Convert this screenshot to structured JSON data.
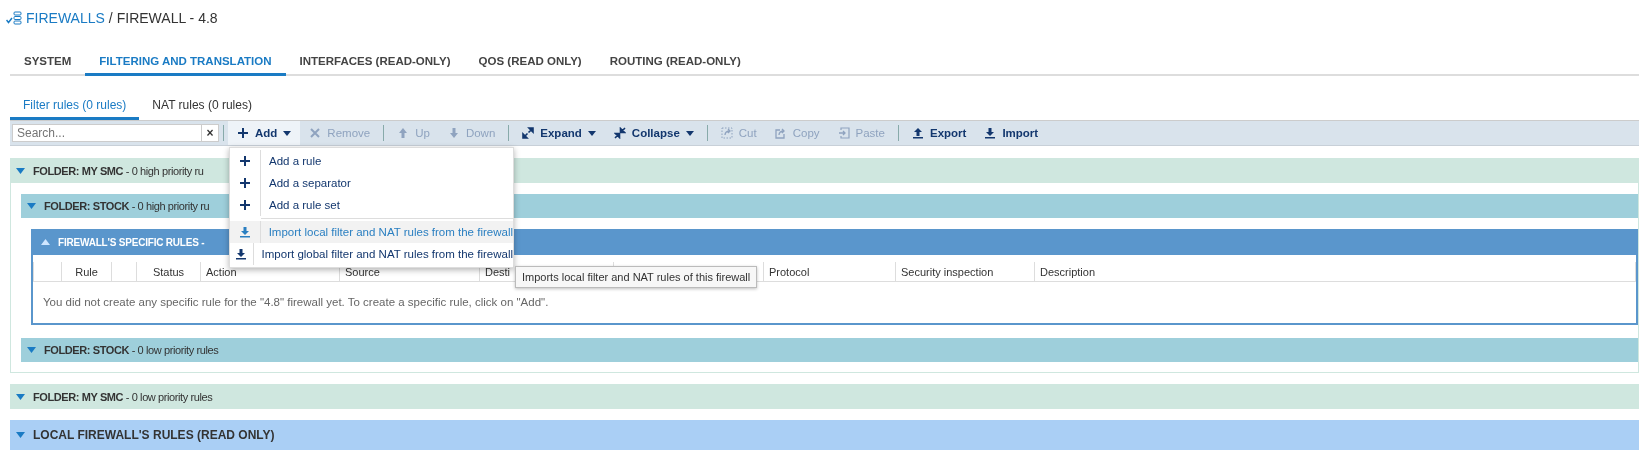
{
  "breadcrumb": {
    "parent": "FIREWALLS",
    "separator": "/",
    "current": "FIREWALL - 4.8"
  },
  "tabs": [
    {
      "label": "SYSTEM",
      "selected": false
    },
    {
      "label": "FILTERING AND TRANSLATION",
      "selected": true
    },
    {
      "label": "INTERFACES (READ-ONLY)",
      "selected": false
    },
    {
      "label": "QOS (READ ONLY)",
      "selected": false
    },
    {
      "label": "ROUTING (READ-ONLY)",
      "selected": false
    }
  ],
  "subtabs": [
    {
      "label": "Filter rules (0 rules)",
      "selected": true
    },
    {
      "label": "NAT rules (0 rules)",
      "selected": false
    }
  ],
  "toolbar": {
    "search": {
      "placeholder": "Search..."
    },
    "clear": "×",
    "groups": [
      [
        {
          "label": "Add",
          "dropdown": true,
          "disabled": false,
          "pressed": true
        },
        {
          "label": "Remove",
          "dropdown": false,
          "disabled": true,
          "pressed": false
        }
      ],
      [
        {
          "label": "Up",
          "dropdown": false,
          "disabled": true,
          "pressed": false
        },
        {
          "label": "Down",
          "dropdown": false,
          "disabled": true,
          "pressed": false
        }
      ],
      [
        {
          "label": "Expand",
          "dropdown": true,
          "disabled": false,
          "pressed": false
        },
        {
          "label": "Collapse",
          "dropdown": true,
          "disabled": false,
          "pressed": false
        }
      ],
      [
        {
          "label": "Cut",
          "dropdown": false,
          "disabled": true,
          "pressed": false
        },
        {
          "label": "Copy",
          "dropdown": false,
          "disabled": true,
          "pressed": false
        },
        {
          "label": "Paste",
          "dropdown": false,
          "disabled": true,
          "pressed": false
        }
      ],
      [
        {
          "label": "Export",
          "dropdown": false,
          "disabled": false,
          "pressed": false
        },
        {
          "label": "Import",
          "dropdown": false,
          "disabled": false,
          "pressed": false
        }
      ]
    ]
  },
  "add_menu": {
    "groups": [
      [
        {
          "label": "Add a rule",
          "highlighted": false
        },
        {
          "label": "Add a separator",
          "highlighted": false
        },
        {
          "label": "Add a rule set",
          "highlighted": false
        }
      ],
      [
        {
          "label": "Import local filter and NAT rules from the firewall",
          "highlighted": true
        },
        {
          "label": "Import global filter and NAT rules from the firewall",
          "highlighted": false
        }
      ]
    ]
  },
  "tooltip": "Imports local filter and NAT rules of this firewall",
  "sections": [
    {
      "kind": "smc",
      "title": "**FOLDER: MY SMC** - 0 high priority ru",
      "children": [
        {
          "kind": "stock",
          "title": "**FOLDER: STOCK** - 0 high priority ru",
          "children": [
            {
              "kind": "specific",
              "title": "FIREWALL'S SPECIFIC RULES -",
              "columns": [
                {
                  "kind": "blank"
                },
                {
                  "kind": "text",
                  "label": "Rule"
                },
                {
                  "kind": "blank"
                },
                {
                  "kind": "text",
                  "label": "Status"
                },
                {
                  "kind": "text",
                  "label": "Action"
                },
                {
                  "kind": "text",
                  "label": "Source"
                },
                {
                  "kind": "text",
                  "label": "Desti"
                },
                {
                  "kind": "blank"
                },
                {
                  "kind": "text",
                  "label": "Protocol"
                },
                {
                  "kind": "text",
                  "label": "Security inspection"
                },
                {
                  "kind": "text",
                  "label": "Description"
                }
              ],
              "empty_message": "You did not create any specific rule for the \"4.8\" firewall yet. To create a specific rule, click on \"Add\"."
            }
          ]
        },
        {
          "kind": "stock",
          "title": "**FOLDER: STOCK** - 0 low priority rules"
        }
      ]
    },
    {
      "kind": "smc",
      "title": "**FOLDER: MY SMC** - 0 low priority rules"
    },
    {
      "kind": "local",
      "title": "LOCAL FIREWALL'S RULES (READ ONLY)"
    }
  ]
}
